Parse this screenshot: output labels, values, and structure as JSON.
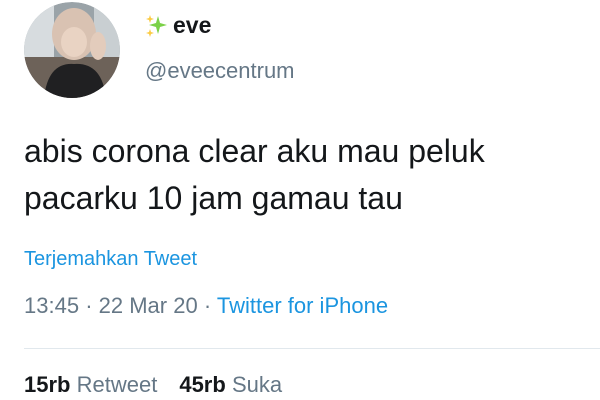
{
  "author": {
    "display_name": "eve",
    "handle": "@eveecentrum",
    "name_prefix_icon": "sparkles-icon",
    "avatar_icon": "profile-photo"
  },
  "tweet": {
    "text_line1": "abis corona clear aku mau peluk",
    "text_line2": "pacarku 10 jam gamau tau",
    "translate_label": "Terjemahkan Tweet"
  },
  "meta": {
    "time": "13:45",
    "separator": "·",
    "date": "22 Mar 20",
    "source": "Twitter for iPhone"
  },
  "stats": {
    "retweet_count": "15rb",
    "retweet_label": "Retweet",
    "like_count": "45rb",
    "like_label": "Suka"
  },
  "colors": {
    "link_blue": "#1b95e0",
    "secondary_gray": "#657786",
    "text_dark": "#14171a",
    "sparkle_green": "#7bd148",
    "sparkle_yellow": "#fbcb43"
  }
}
